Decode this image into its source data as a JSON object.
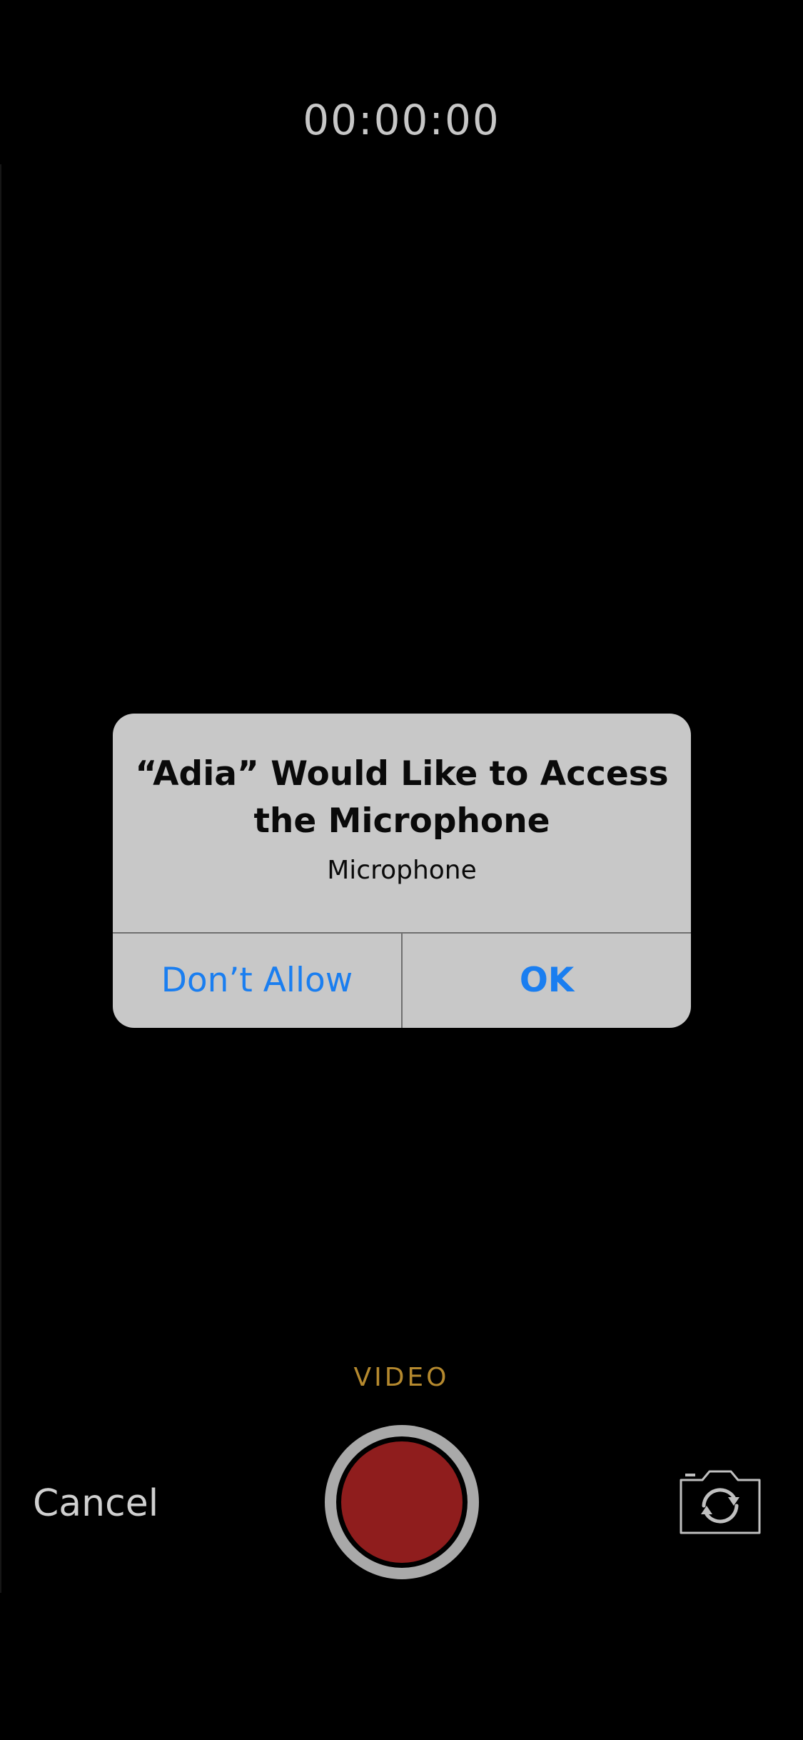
{
  "recorder": {
    "timer": "00:00:00",
    "mode_label": "VIDEO",
    "cancel_label": "Cancel",
    "record_color": "#8f1d1d"
  },
  "alert": {
    "title": "“Adia” Would Like to Access the Microphone",
    "message": "Microphone",
    "deny_label": "Don’t Allow",
    "ok_label": "OK",
    "button_color": "#1a7ef0"
  },
  "icons": {
    "flip_camera": "camera-flip-icon"
  }
}
